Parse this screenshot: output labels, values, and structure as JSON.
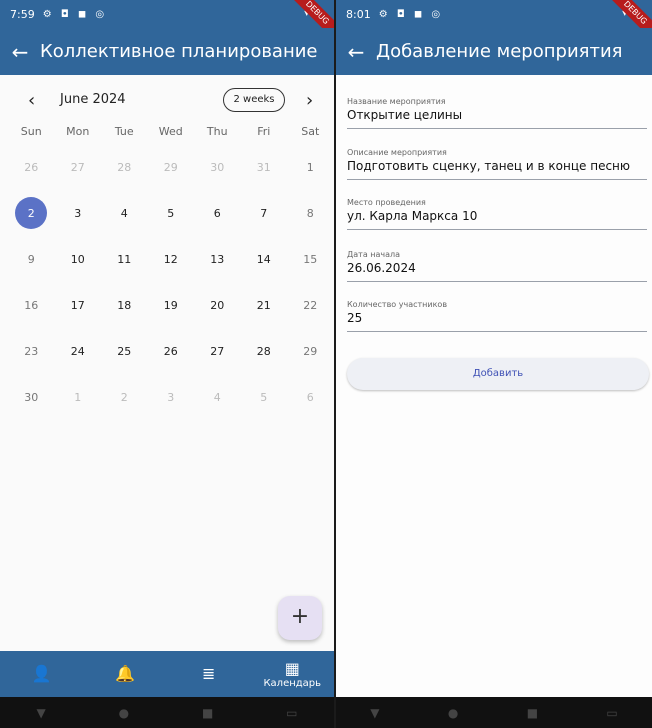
{
  "left": {
    "status": {
      "time": "7:59",
      "icons": "⚙ ◘ ◼ ◎",
      "right_icons": "▾ ▮",
      "debug": "DEBUG"
    },
    "appbar": {
      "title": "Коллективное планирование"
    },
    "calendar": {
      "month": "June 2024",
      "format_button": "2 weeks",
      "weekdays": [
        "Sun",
        "Mon",
        "Tue",
        "Wed",
        "Thu",
        "Fri",
        "Sat"
      ],
      "days": [
        "26",
        "27",
        "28",
        "29",
        "30",
        "31",
        "1",
        "2",
        "3",
        "4",
        "5",
        "6",
        "7",
        "8",
        "9",
        "10",
        "11",
        "12",
        "13",
        "14",
        "15",
        "16",
        "17",
        "18",
        "19",
        "20",
        "21",
        "22",
        "23",
        "24",
        "25",
        "26",
        "27",
        "28",
        "29",
        "30",
        "1",
        "2",
        "3",
        "4",
        "5",
        "6"
      ],
      "selected_day": "2"
    },
    "fab": "+",
    "bottomnav": [
      {
        "icon": "👤",
        "label": ""
      },
      {
        "icon": "🔔",
        "label": ""
      },
      {
        "icon": "≣",
        "label": ""
      },
      {
        "icon": "▦",
        "label": "Календарь"
      }
    ]
  },
  "right": {
    "status": {
      "time": "8:01",
      "icons": "⚙ ◘ ◼ ◎",
      "right_icons": "▾ ▮",
      "debug": "DEBUG"
    },
    "appbar": {
      "title": "Добавление мероприятия"
    },
    "fields": [
      {
        "label": "Название мероприятия",
        "value": "Открытие целины"
      },
      {
        "label": "Описание мероприятия",
        "value": "Подготовить сценку, танец и в конце песню"
      },
      {
        "label": "Место проведения",
        "value": "ул. Карла Маркса 10"
      },
      {
        "label": "Дата начала",
        "value": "26.06.2024"
      },
      {
        "label": "Количество участников",
        "value": "25"
      }
    ],
    "add_button": "Добавить"
  },
  "sysnav": {
    "back": "▼",
    "home": "●",
    "recents": "■",
    "extra": "▭"
  }
}
